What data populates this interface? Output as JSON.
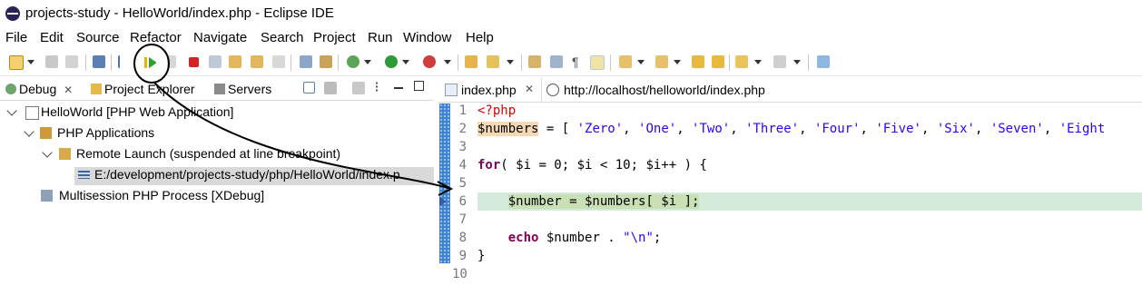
{
  "window": {
    "title": "projects-study - HelloWorld/index.php - Eclipse IDE"
  },
  "menu": [
    "File",
    "Edit",
    "Source",
    "Refactor",
    "Navigate",
    "Search",
    "Project",
    "Run",
    "Window",
    "Help"
  ],
  "left_tabs": {
    "debug": "Debug",
    "explorer": "Project Explorer",
    "servers": "Servers"
  },
  "tree": {
    "app": "HelloWorld [PHP Web Application]",
    "php_apps": "PHP Applications",
    "remote": "Remote Launch (suspended at line breakpoint)",
    "frame": "E:/development/projects-study/php/HelloWorld/index.p",
    "process": "Multisession PHP Process [XDebug]"
  },
  "editor_tabs": {
    "file": "index.php",
    "browser": "http://localhost/helloworld/index.php"
  },
  "code_lines": [
    {
      "num": "1",
      "text": "<?php"
    },
    {
      "num": "2",
      "text": "$numbers = [ 'Zero', 'One', 'Two', 'Three', 'Four', 'Five', 'Six', 'Seven', 'Eight"
    },
    {
      "num": "3",
      "text": ""
    },
    {
      "num": "4",
      "text": "for( $i = 0; $i < 10; $i++ ) {"
    },
    {
      "num": "5",
      "text": ""
    },
    {
      "num": "6",
      "text": "    $number = $numbers[ $i ];"
    },
    {
      "num": "7",
      "text": ""
    },
    {
      "num": "8",
      "text": "    echo $number . \"\\n\";"
    },
    {
      "num": "9",
      "text": "}"
    },
    {
      "num": "10",
      "text": ""
    }
  ],
  "colors": {
    "keyword": "#7f0055",
    "string": "#2a00ff",
    "php_tag": "#e00000",
    "current_line": "#d4eadb",
    "ruler": "#3d82cf"
  }
}
